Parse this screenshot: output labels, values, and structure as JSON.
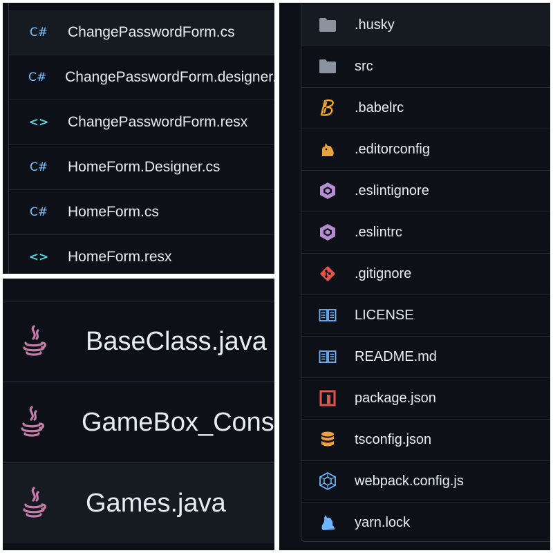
{
  "top_left": {
    "files": [
      {
        "icon": "csharp-file-icon",
        "icon_text": "C#",
        "name": "ChangePasswordForm.cs"
      },
      {
        "icon": "csharp-file-icon",
        "icon_text": "C#",
        "name": "ChangePasswordForm.designer.cs"
      },
      {
        "icon": "resx-file-icon",
        "icon_text": "<>",
        "name": "ChangePasswordForm.resx"
      },
      {
        "icon": "csharp-file-icon",
        "icon_text": "C#",
        "name": "HomeForm.Designer.cs"
      },
      {
        "icon": "csharp-file-icon",
        "icon_text": "C#",
        "name": "HomeForm.cs"
      },
      {
        "icon": "resx-file-icon",
        "icon_text": "<>",
        "name": "HomeForm.resx"
      }
    ]
  },
  "bottom_left": {
    "files": [
      {
        "icon": "java-file-icon",
        "name": "BaseClass.java"
      },
      {
        "icon": "java-file-icon",
        "name": "GameBox_Console.java"
      },
      {
        "icon": "java-file-icon",
        "name": "Games.java"
      }
    ]
  },
  "right": {
    "files": [
      {
        "icon": "folder-icon",
        "name": ".husky"
      },
      {
        "icon": "folder-icon",
        "name": "src"
      },
      {
        "icon": "babel-icon",
        "name": ".babelrc"
      },
      {
        "icon": "editorconfig-icon",
        "name": ".editorconfig"
      },
      {
        "icon": "eslint-icon",
        "name": ".eslintignore"
      },
      {
        "icon": "eslint-icon",
        "name": ".eslintrc"
      },
      {
        "icon": "git-icon",
        "name": ".gitignore"
      },
      {
        "icon": "book-icon",
        "name": "LICENSE"
      },
      {
        "icon": "book-icon",
        "name": "README.md"
      },
      {
        "icon": "npm-icon",
        "name": "package.json"
      },
      {
        "icon": "database-icon",
        "name": "tsconfig.json"
      },
      {
        "icon": "webpack-icon",
        "name": "webpack.config.js"
      },
      {
        "icon": "yarn-icon",
        "name": "yarn.lock"
      }
    ]
  },
  "colors": {
    "background": "#0d1117",
    "row_highlight": "#161b22",
    "border": "#30363d",
    "text": "#e6edf3",
    "csharp": "#79c0ff",
    "resx": "#56d4dd",
    "java": "#c77daa",
    "folder": "#8b949e",
    "babel": "#f5a623",
    "editorconfig": "#e8a33d",
    "eslint": "#b48ecf",
    "git": "#e5534b",
    "book": "#6cb6ff",
    "npm": "#e5534b",
    "database": "#f0a03c",
    "webpack": "#6cb6ff",
    "yarn": "#6cb6ff"
  }
}
